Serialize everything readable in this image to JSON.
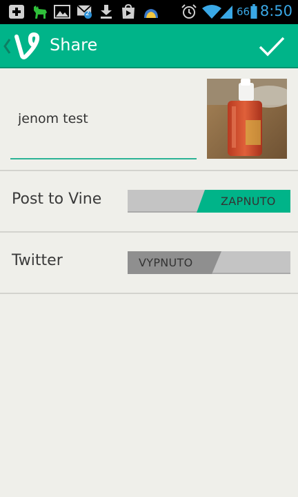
{
  "status_bar": {
    "battery_level": "66",
    "time": "8:50",
    "notification_badge": "2",
    "icons": [
      "plus-box-icon",
      "deer-icon",
      "image-icon",
      "mail-icon",
      "download-icon",
      "play-store-icon",
      "cloud-icon",
      "alarm-icon",
      "wifi-icon",
      "signal-icon",
      "battery-icon"
    ]
  },
  "action_bar": {
    "title": "Share",
    "confirm_icon": "check-icon",
    "accent": "#00b489"
  },
  "compose": {
    "caption_value": "jenom test",
    "underline_color": "#2ab294"
  },
  "rows": [
    {
      "label": "Post to Vine",
      "state": "ZAPNUTO",
      "on": true
    },
    {
      "label": "Twitter",
      "state": "VYPNUTO",
      "on": false
    }
  ]
}
